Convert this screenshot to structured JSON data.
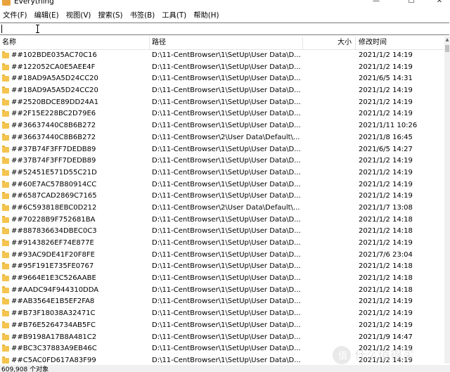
{
  "window": {
    "title": "Everything",
    "minimize": "—",
    "maximize": "☐",
    "close": "✕"
  },
  "menu": [
    "文件(F)",
    "编辑(E)",
    "视图(V)",
    "搜索(S)",
    "书签(B)",
    "工具(T)",
    "帮助(H)"
  ],
  "search": {
    "value": "",
    "placeholder": ""
  },
  "columns": {
    "name": "名称",
    "path": "路径",
    "size": "大小",
    "modified": "修改时间"
  },
  "rows": [
    {
      "name": "##102BDE035AC70C16",
      "path": "D:\\11-CentBrowser\\1\\SetUp\\User Data\\D...",
      "modified": "2021/1/2 14:19"
    },
    {
      "name": "##122052CA0E5AEE4F",
      "path": "D:\\11-CentBrowser\\1\\SetUp\\User Data\\D...",
      "modified": "2021/1/2 14:19"
    },
    {
      "name": "##18AD9A5A5D24CC20",
      "path": "D:\\11-CentBrowser\\1\\SetUp\\User Data\\D...",
      "modified": "2021/6/5 14:31"
    },
    {
      "name": "##18AD9A5A5D24CC20",
      "path": "D:\\11-CentBrowser\\1\\SetUp\\User Data\\D...",
      "modified": "2021/1/2 14:19"
    },
    {
      "name": "##2520BDCE89DD24A1",
      "path": "D:\\11-CentBrowser\\1\\SetUp\\User Data\\D...",
      "modified": "2021/1/2 14:19"
    },
    {
      "name": "##2F15E228BC2D79E6",
      "path": "D:\\11-CentBrowser\\1\\SetUp\\User Data\\D...",
      "modified": "2021/1/2 14:19"
    },
    {
      "name": "##36637440C8B6B272",
      "path": "D:\\11-CentBrowser\\1\\SetUp\\User Data\\D...",
      "modified": "2021/1/11 10:26"
    },
    {
      "name": "##36637440C8B6B272",
      "path": "D:\\11-CentBrowser\\2\\User Data\\Default\\...",
      "modified": "2021/1/8 16:45"
    },
    {
      "name": "##37B74F3FF7DEDB89",
      "path": "D:\\11-CentBrowser\\1\\SetUp\\User Data\\D...",
      "modified": "2021/6/5 14:27"
    },
    {
      "name": "##37B74F3FF7DEDB89",
      "path": "D:\\11-CentBrowser\\1\\SetUp\\User Data\\D...",
      "modified": "2021/1/2 14:19"
    },
    {
      "name": "##52451E571D55C21D",
      "path": "D:\\11-CentBrowser\\1\\SetUp\\User Data\\D...",
      "modified": "2021/1/2 14:19"
    },
    {
      "name": "##60E7AC57B80914CC",
      "path": "D:\\11-CentBrowser\\1\\SetUp\\User Data\\D...",
      "modified": "2021/1/2 14:19"
    },
    {
      "name": "##6587CAD2869C7165",
      "path": "D:\\11-CentBrowser\\1\\SetUp\\User Data\\D...",
      "modified": "2021/1/2 14:19"
    },
    {
      "name": "##6C593818EBC0D212",
      "path": "D:\\11-CentBrowser\\2\\User Data\\Default\\...",
      "modified": "2021/1/7 13:08"
    },
    {
      "name": "##70228B9F752681BA",
      "path": "D:\\11-CentBrowser\\1\\SetUp\\User Data\\D...",
      "modified": "2021/1/2 14:18"
    },
    {
      "name": "##887836634DBEC0C3",
      "path": "D:\\11-CentBrowser\\1\\SetUp\\User Data\\D...",
      "modified": "2021/1/2 14:18"
    },
    {
      "name": "##9143826EF74E877E",
      "path": "D:\\11-CentBrowser\\1\\SetUp\\User Data\\D...",
      "modified": "2021/1/2 14:19"
    },
    {
      "name": "##93AC9DE41F20F8FE",
      "path": "D:\\11-CentBrowser\\1\\SetUp\\User Data\\D...",
      "modified": "2021/7/6 23:04"
    },
    {
      "name": "##95F191E735FE0767",
      "path": "D:\\11-CentBrowser\\1\\SetUp\\User Data\\D...",
      "modified": "2021/1/2 14:18"
    },
    {
      "name": "##9664E1E3C526AABE",
      "path": "D:\\11-CentBrowser\\1\\SetUp\\User Data\\D...",
      "modified": "2021/1/2 14:18"
    },
    {
      "name": "##AADC94F944310DDA",
      "path": "D:\\11-CentBrowser\\1\\SetUp\\User Data\\D...",
      "modified": "2021/1/2 14:18"
    },
    {
      "name": "##AB3564E1B5EF2FA8",
      "path": "D:\\11-CentBrowser\\1\\SetUp\\User Data\\D...",
      "modified": "2021/1/2 14:19"
    },
    {
      "name": "##B73F18038A32471C",
      "path": "D:\\11-CentBrowser\\1\\SetUp\\User Data\\D...",
      "modified": "2021/1/2 14:19"
    },
    {
      "name": "##B76E5264734AB5FC",
      "path": "D:\\11-CentBrowser\\1\\SetUp\\User Data\\D...",
      "modified": "2021/1/2 14:19"
    },
    {
      "name": "##B9198A17B8A481C2",
      "path": "D:\\11-CentBrowser\\1\\SetUp\\User Data\\D...",
      "modified": "2021/1/9 14:47"
    },
    {
      "name": "##BC3C37883A9EB46C",
      "path": "D:\\11-CentBrowser\\1\\SetUp\\User Data\\D...",
      "modified": "2021/1/2 14:19"
    },
    {
      "name": "##C5AC0FD617A83F99",
      "path": "D:\\11-CentBrowser\\1\\SetUp\\User Data\\D...",
      "modified": "2021/1/2 14:19"
    }
  ],
  "status": {
    "text": "609,908 个对象"
  },
  "watermark": {
    "text": "什么值得买"
  },
  "colors": {
    "folder": "#f4c44e",
    "app_icon": "#e8a33c"
  }
}
